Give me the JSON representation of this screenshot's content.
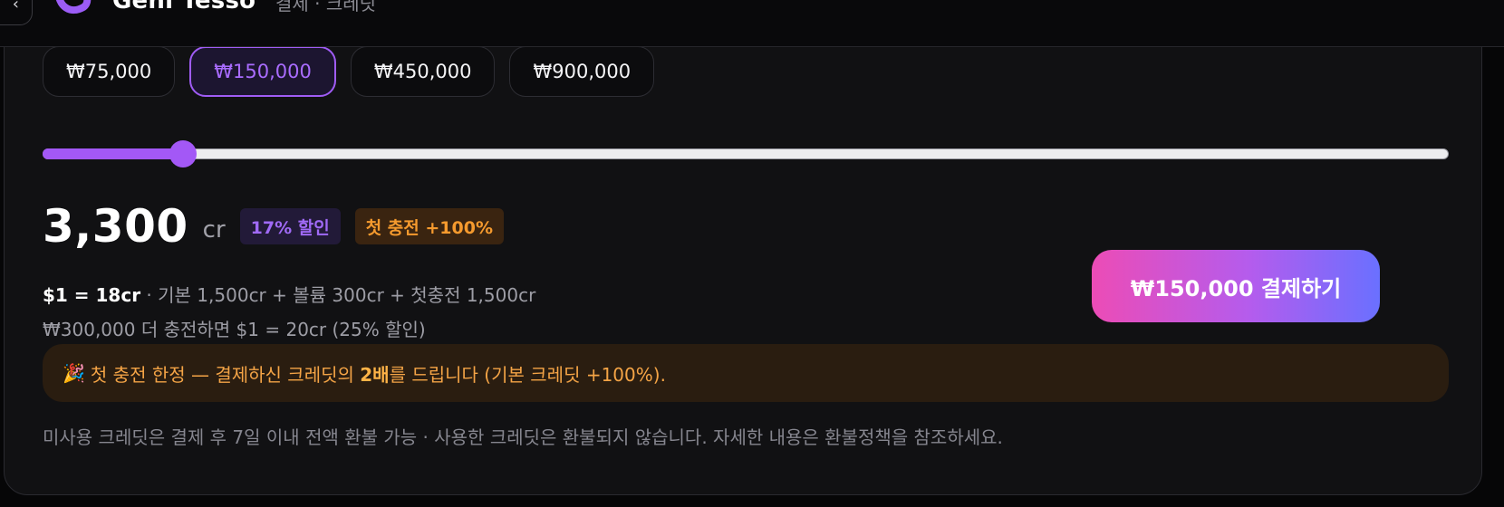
{
  "header": {
    "brand": "Geni Tesso",
    "nav_sub": "결제 · 크레딧",
    "back_glyph": "‹",
    "accent_color": "#a358f6"
  },
  "presets": [
    {
      "label": "₩75,000",
      "active": false
    },
    {
      "label": "₩150,000",
      "active": true
    },
    {
      "label": "₩450,000",
      "active": false
    },
    {
      "label": "₩900,000",
      "active": false
    }
  ],
  "slider": {
    "fraction": 0.1
  },
  "credits": {
    "amount": "3,300",
    "unit": "cr",
    "discount_badge": "17% 할인",
    "first_charge_badge": "첫 충전 +100%",
    "rate": "$1 = 18cr",
    "breakdown": " · 기본 1,500cr + 볼륨 300cr + 첫충전 1,500cr",
    "upsell": "₩300,000 더 충전하면 $1 = 20cr (25% 할인)"
  },
  "pay_button": {
    "label": "₩150,000 결제하기"
  },
  "promo": {
    "icon": "party-popper-icon",
    "glyph": "🎉",
    "text_before": "첫 충전 한정 — 결제하신 크레딧의 ",
    "text_bold": "2배",
    "text_after": "를 드립니다 (기본 크레딧 +100%)."
  },
  "refund_note": "미사용 크레딧은 결제 후 7일 이내 전액 환불 가능 · 사용한 크레딧은 환불되지 않습니다. 자세한 내용은 환불정책을 참조하세요."
}
